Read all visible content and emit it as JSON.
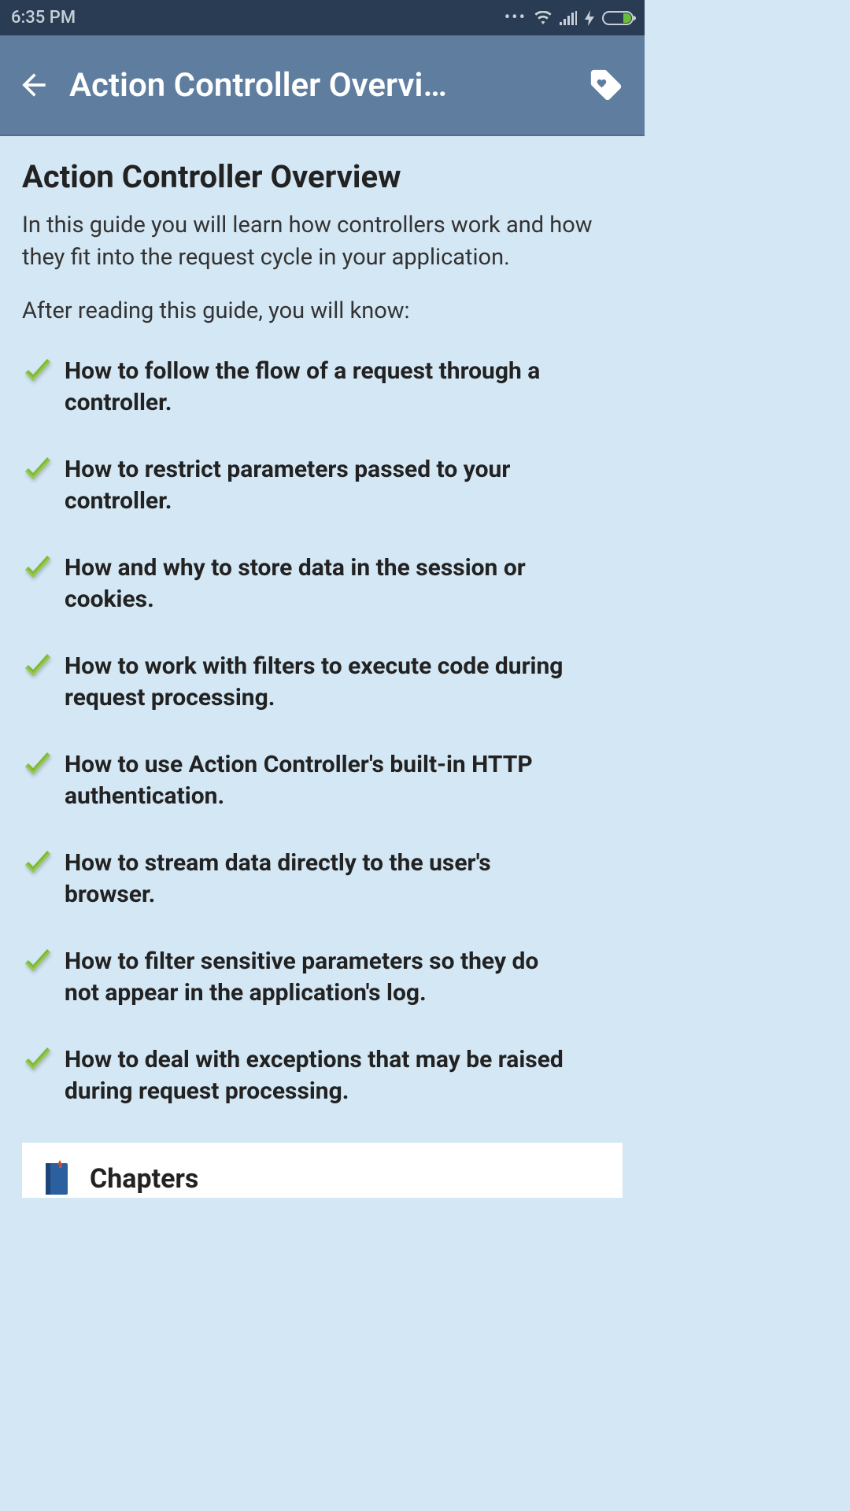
{
  "status_bar": {
    "time": "6:35 PM"
  },
  "header": {
    "title": "Action Controller Overvi…"
  },
  "content": {
    "heading": "Action Controller Overview",
    "intro": "In this guide you will learn how controllers work and how they fit into the request cycle in your application.",
    "lead_in": "After reading this guide, you will know:",
    "bullets": [
      "How to follow the flow of a request through a controller.",
      "How to restrict parameters passed to your controller.",
      "How and why to store data in the session or cookies.",
      "How to work with filters to execute code during request processing.",
      "How to use Action Controller's built-in HTTP authentication.",
      "How to stream data directly to the user's browser.",
      "How to filter sensitive parameters so they do not appear in the application's log.",
      "How to deal with exceptions that may be raised during request processing."
    ]
  },
  "chapters": {
    "title": "Chapters"
  },
  "colors": {
    "status_bar_bg": "#2a3c54",
    "app_bar_bg": "#5f7d9e",
    "content_bg": "#d4e7f4",
    "check_green": "#7fb836"
  }
}
